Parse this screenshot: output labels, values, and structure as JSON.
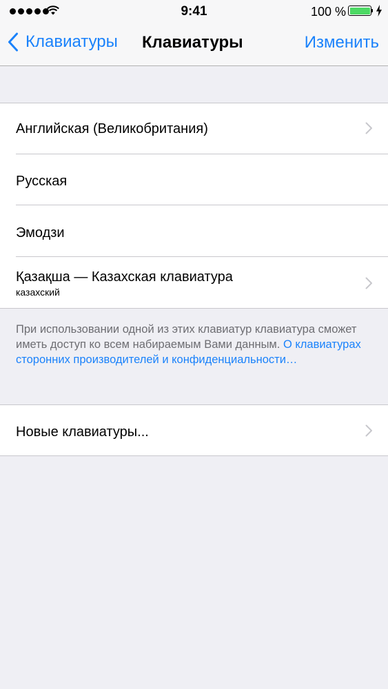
{
  "status_bar": {
    "time": "9:41",
    "battery_percent": "100 %"
  },
  "nav": {
    "back_label": "Клавиатуры",
    "title": "Клавиатуры",
    "action_label": "Изменить"
  },
  "keyboards": [
    {
      "label": "Английская (Великобритания)",
      "sublabel": "",
      "has_chevron": true
    },
    {
      "label": "Русская",
      "sublabel": "",
      "has_chevron": false
    },
    {
      "label": "Эмодзи",
      "sublabel": "",
      "has_chevron": false
    },
    {
      "label": "Қазақша — Казахская клавиатура",
      "sublabel": "казахский",
      "has_chevron": true
    }
  ],
  "footer": {
    "text": "При использовании одной из этих клавиатур клавиатура сможет иметь доступ ко всем набираемым Вами данным.",
    "link": "О клавиатурах сторонних производителей и конфиденциальности…"
  },
  "add_keyboard": {
    "label": "Новые клавиатуры..."
  },
  "colors": {
    "accent": "#1a82fb",
    "background": "#efeff4",
    "battery": "#4cd964"
  }
}
